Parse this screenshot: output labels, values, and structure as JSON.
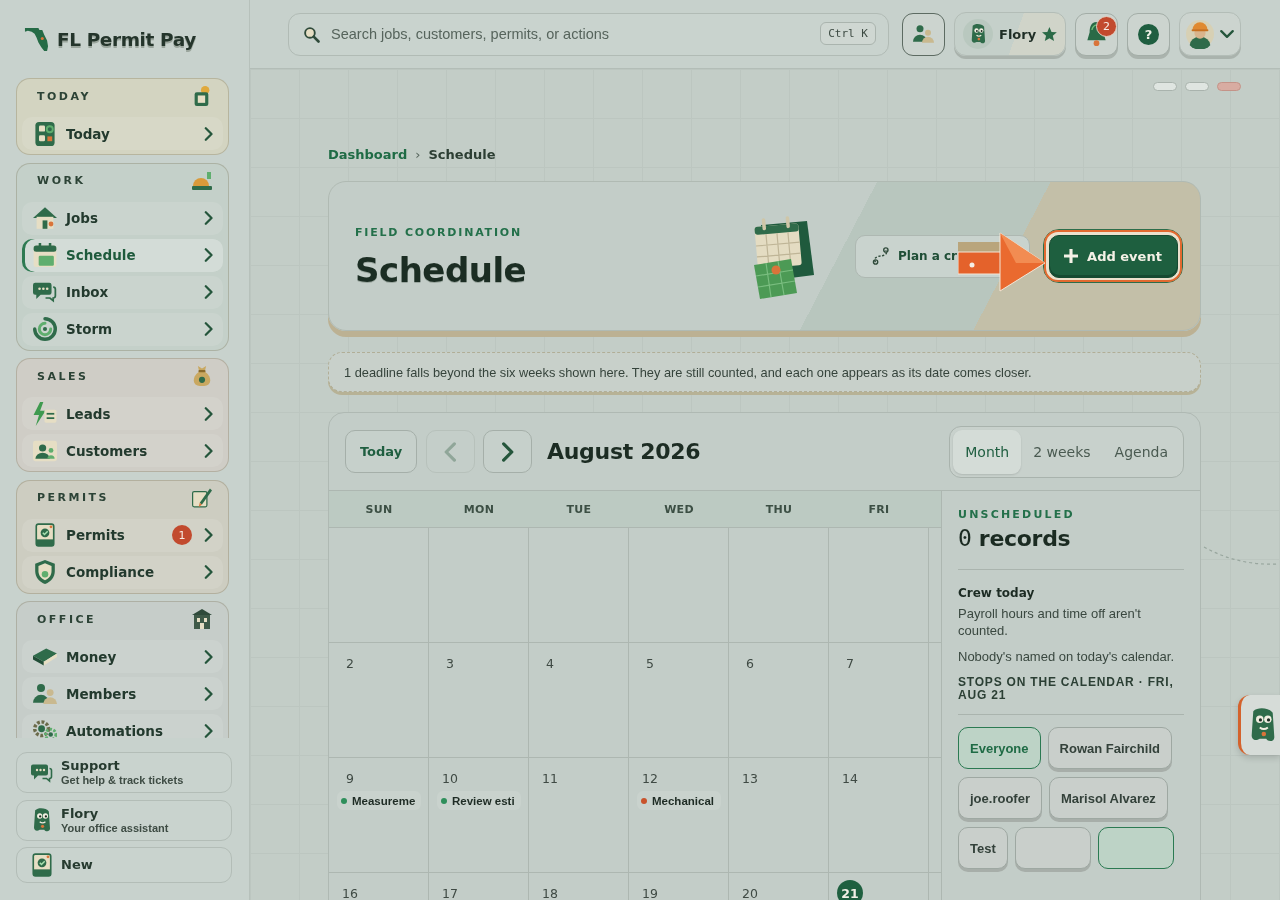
{
  "sidebar": {
    "logo": "FL Permit Pay",
    "sections": [
      {
        "title": "TODAY",
        "color": "#d3d4c1",
        "items": [
          {
            "label": "Today",
            "selected": false
          }
        ]
      },
      {
        "title": "WORK",
        "color": "#c4d0c9",
        "items": [
          {
            "label": "Jobs",
            "selected": false
          },
          {
            "label": "Schedule",
            "selected": true
          },
          {
            "label": "Inbox",
            "selected": false
          },
          {
            "label": "Storm",
            "selected": false
          }
        ]
      },
      {
        "title": "SALES",
        "color": "#cfcdc6",
        "items": [
          {
            "label": "Leads",
            "selected": false
          },
          {
            "label": "Customers",
            "selected": false
          }
        ]
      },
      {
        "title": "PERMITS",
        "color": "#cdcdc1",
        "items": [
          {
            "label": "Permits",
            "selected": false,
            "badge": "1"
          },
          {
            "label": "Compliance",
            "selected": false
          }
        ]
      },
      {
        "title": "OFFICE",
        "color": "#c6cdc9",
        "items": [
          {
            "label": "Money",
            "selected": false
          },
          {
            "label": "Members",
            "selected": false
          },
          {
            "label": "Automations",
            "selected": false
          }
        ]
      }
    ],
    "footer_links": [
      {
        "title": "Support",
        "subtitle": "Get help & track tickets"
      },
      {
        "title": "Flory",
        "subtitle": "Your office assistant"
      },
      {
        "title": "New"
      }
    ]
  },
  "topbar": {
    "search": {
      "placeholder": "Search jobs, customers, permits, or actions",
      "shortcut": "Ctrl K"
    },
    "assistant": {
      "name": "Flory"
    },
    "notifications": {
      "badge": "2"
    },
    "help": "?"
  },
  "breadcrumb": {
    "items": [
      {
        "label": "Dashboard",
        "kind": "link"
      },
      {
        "label": "Schedule",
        "kind": "current"
      }
    ],
    "separator": "›"
  },
  "header": {
    "eyebrow": "FIELD COORDINATION",
    "title": "Schedule",
    "secondary_button": {
      "label": "Plan a cr"
    },
    "primary_button": {
      "label": "Add event",
      "highlighted": true
    }
  },
  "notice": "1 deadline falls beyond the six weeks shown here. They are still counted, and each one appears as its date comes closer.",
  "calendar": {
    "today_button": "Today",
    "prev_disabled": true,
    "month": "August 2026",
    "views": [
      {
        "label": "Month",
        "selected": true
      },
      {
        "label": "2 weeks",
        "selected": false
      },
      {
        "label": "Agenda",
        "selected": false
      }
    ],
    "weekdays": [
      "SUN",
      "MON",
      "TUE",
      "WED",
      "THU",
      "FRI"
    ],
    "first_week_blank": true,
    "weeks": [
      [
        {
          "day": "2",
          "today": false
        },
        {
          "day": "3",
          "today": false
        },
        {
          "day": "4",
          "today": false
        },
        {
          "day": "5",
          "today": false
        },
        {
          "day": "6",
          "today": false
        },
        {
          "day": "7",
          "today": false
        }
      ],
      [
        {
          "day": "9",
          "today": false,
          "events": [
            {
              "title": "Measureme",
              "color": "#2f8f5b"
            }
          ]
        },
        {
          "day": "10",
          "today": false,
          "events": [
            {
              "title": "Review esti",
              "color": "#2f8f5b"
            }
          ]
        },
        {
          "day": "11",
          "today": false
        },
        {
          "day": "12",
          "today": false,
          "events": [
            {
              "title": "Mechanical",
              "color": "#c9532c"
            }
          ]
        },
        {
          "day": "13",
          "today": false
        },
        {
          "day": "14",
          "today": false
        }
      ],
      [
        {
          "day": "16",
          "today": false
        },
        {
          "day": "17",
          "today": false
        },
        {
          "day": "18",
          "today": false
        },
        {
          "day": "19",
          "today": false
        },
        {
          "day": "20",
          "today": false
        },
        {
          "day": "21",
          "today": true
        }
      ]
    ]
  },
  "side_panel": {
    "eyebrow": "UNSCHEDULED",
    "count": "0",
    "count_label": "records",
    "crew_title": "Crew today",
    "crew_note": "Payroll hours and time off aren't counted.",
    "crew_empty": "Nobody's named on today's calendar.",
    "stops_title": "STOPS ON THE CALENDAR · FRI, AUG 21",
    "filters": [
      {
        "label": "Everyone",
        "selected": true
      },
      {
        "label": "Rowan Fairchild",
        "selected": false
      },
      {
        "label": "joe.roofer",
        "selected": false
      },
      {
        "label": "Marisol Alvarez",
        "selected": false
      },
      {
        "label": "Test",
        "selected": false
      },
      {
        "selected": false
      },
      {
        "selected": true
      }
    ]
  }
}
